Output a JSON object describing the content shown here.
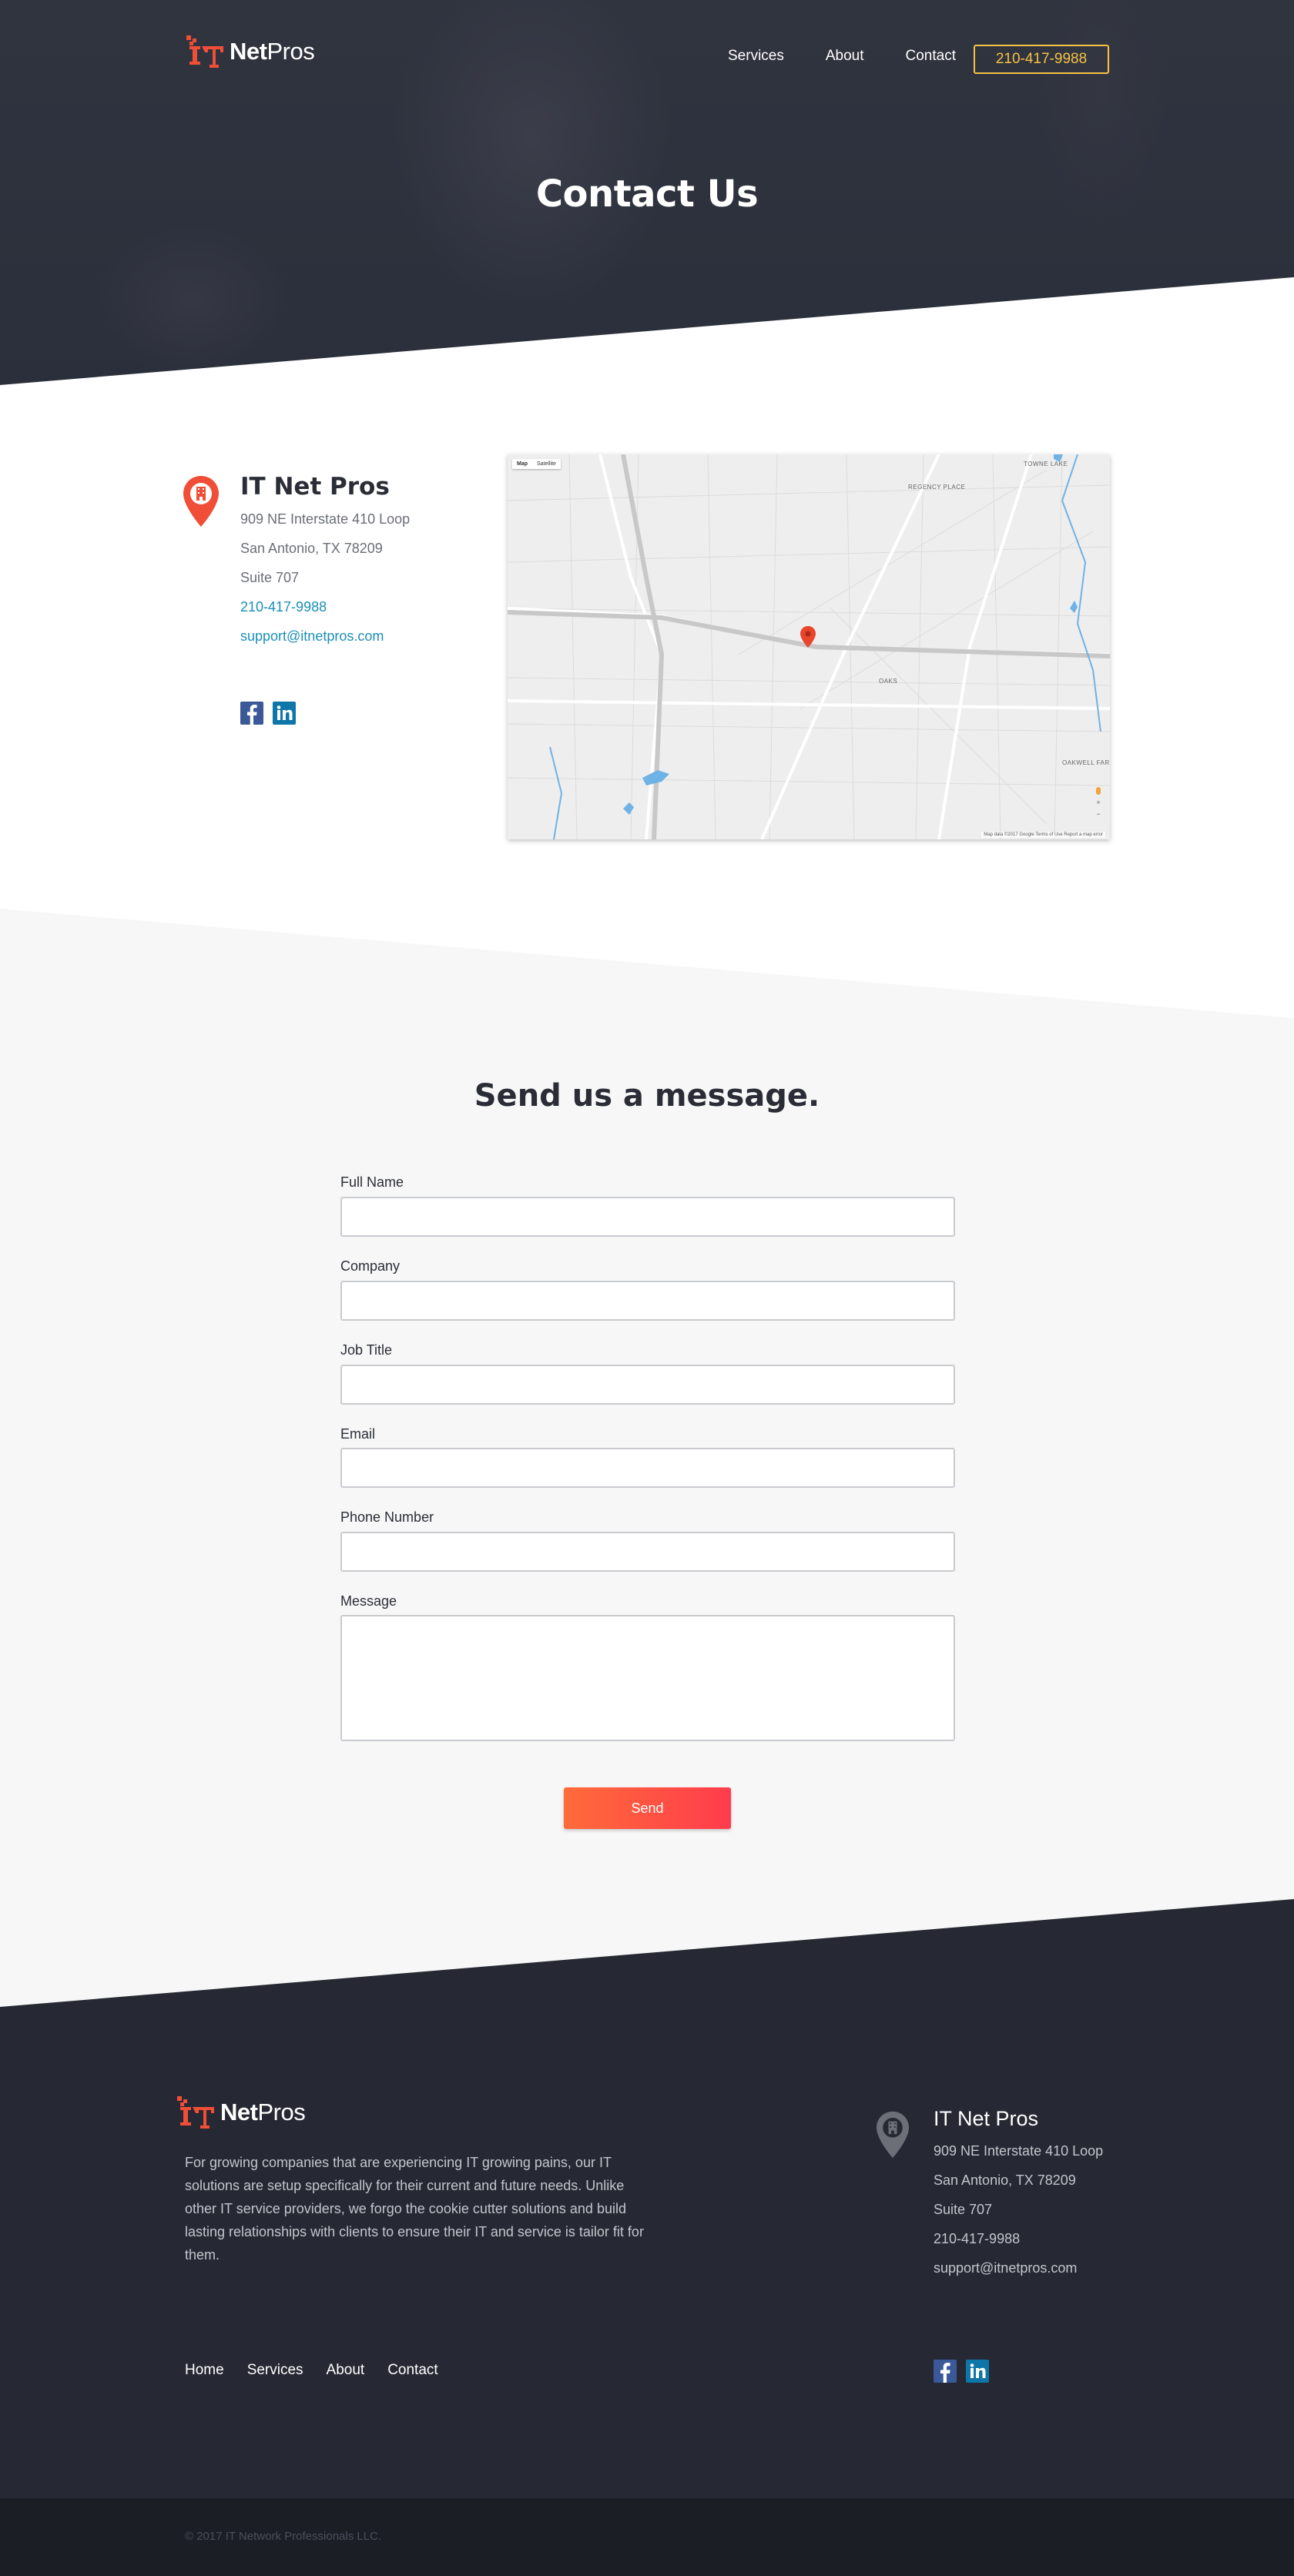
{
  "brand": {
    "logo_bold": "Net",
    "logo_light": "Pros",
    "accent_color": "#f04e37",
    "dark_color": "#262934"
  },
  "nav": {
    "items": [
      {
        "label": "Services"
      },
      {
        "label": "About"
      },
      {
        "label": "Contact"
      }
    ],
    "phone": "210-417-9988"
  },
  "hero": {
    "title": "Contact Us"
  },
  "contact": {
    "name": "IT Net Pros",
    "address1": "909 NE Interstate 410 Loop",
    "address2": "San Antonio, TX 78209",
    "suite": "Suite 707",
    "phone": "210-417-9988",
    "email": "support@itnetpros.com",
    "social_icons": [
      "facebook-icon",
      "linkedin-icon"
    ]
  },
  "map": {
    "tabs": [
      "Map",
      "Satellite"
    ],
    "labels": {
      "towne_lake": "TOWNE LAKE",
      "regency_place": "REGENCY PLACE",
      "oaks": "OAKS",
      "oakwell": "OAKWELL FAR"
    },
    "attribution": "Map data ©2017 Google   Terms of Use   Report a map error"
  },
  "form": {
    "title": "Send us a message.",
    "fields": [
      {
        "label": "Full Name",
        "value": ""
      },
      {
        "label": "Company",
        "value": ""
      },
      {
        "label": "Job Title",
        "value": ""
      },
      {
        "label": "Email",
        "value": ""
      },
      {
        "label": "Phone Number",
        "value": ""
      },
      {
        "label": "Message",
        "value": ""
      }
    ],
    "submit_label": "Send"
  },
  "footer": {
    "about": "For growing companies that are experiencing IT growing pains, our IT solutions are setup specifically for their current and future needs. Unlike other IT service providers, we forgo the cookie cutter solutions and build lasting relationships with clients to ensure their IT and service is tailor fit for them.",
    "name": "IT Net Pros",
    "address1": "909 NE Interstate 410 Loop",
    "address2": "San Antonio, TX 78209",
    "suite": "Suite 707",
    "phone": "210-417-9988",
    "email": "support@itnetpros.com",
    "nav": [
      {
        "label": "Home"
      },
      {
        "label": "Services"
      },
      {
        "label": "About"
      },
      {
        "label": "Contact"
      }
    ],
    "copyright": "© 2017 IT Network Professionals LLC."
  }
}
